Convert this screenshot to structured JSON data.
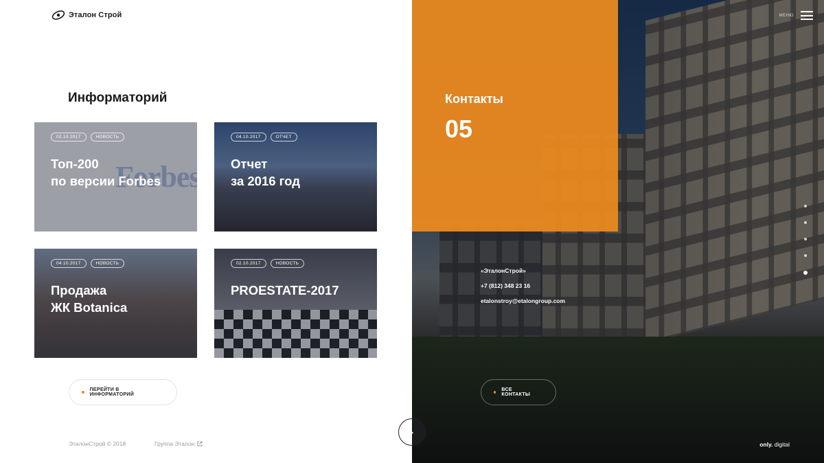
{
  "header": {
    "logo_text": "Эталон Строй",
    "menu_label": "МЕНЮ"
  },
  "info": {
    "title": "Информаторий",
    "cards": [
      {
        "date": "02.10.2017",
        "tag": "НОВОСТЬ",
        "headline": "Топ-200\nпо версии Forbes",
        "bg_word": "Forbes"
      },
      {
        "date": "04.10.2017",
        "tag": "ОТЧЕТ",
        "headline": "Отчет\nза 2016 год"
      },
      {
        "date": "04.10.2017",
        "tag": "НОВОСТЬ",
        "headline": "Продажа\nЖК Botanica"
      },
      {
        "date": "02.10.2017",
        "tag": "НОВОСТЬ",
        "headline": "PROESTATE-2017"
      }
    ],
    "button_label": "ПЕРЕЙТИ В ИНФОРМАТОРИЙ"
  },
  "footer": {
    "copyright": "ЭталонСтрой © 2018",
    "group_link": "Группа Эталон"
  },
  "contacts": {
    "title": "Контакты",
    "number": "05",
    "company": "«ЭталонСтрой»",
    "phone": "+7 (812) 348 23 16",
    "email": "etalonstroy@etalongroup.com",
    "button_label": "ВСЕ КОНТАКТЫ"
  },
  "brand": {
    "strong": "only.",
    "rest": " digital"
  },
  "pagination": {
    "total": 5,
    "active": 5
  },
  "colors": {
    "accent": "#ee8b1e",
    "text": "#1b1b1b",
    "muted": "#9a9a9a"
  }
}
